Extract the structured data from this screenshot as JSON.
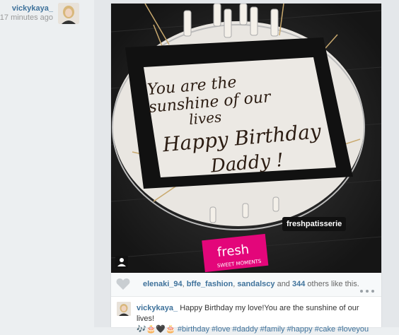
{
  "post_header": {
    "username": "vickykaya_",
    "timestamp": "17 minutes ago"
  },
  "photo": {
    "tag_label": "freshpatisserie",
    "cake_text": [
      "You are the",
      "sunshine of our",
      "lives",
      "Happy Birthday",
      "Daddy !"
    ],
    "box_brand": "fresh",
    "box_subtitle": "SWEET MOMENTS"
  },
  "likes": {
    "users": [
      "elenaki_94",
      "bffe_fashion",
      "sandalscy"
    ],
    "count": "344",
    "suffix": "others like this.",
    "sep1": ", ",
    "sep2": ", ",
    "and_text": " and ",
    "space": " "
  },
  "caption": {
    "username": "vickykaya_",
    "text": "Happy Birthday my love!You are the sunshine of our lives!",
    "emojis": "🎶🎂🖤🎂",
    "hashtags": "#birthday #love #daddy #family #happy #cake #loveyou"
  },
  "icons": {
    "heart": "heart-icon",
    "more": "more-icon",
    "user_tag": "user-tag-icon"
  },
  "colors": {
    "link": "#3f729b",
    "background": "#eceff1"
  }
}
